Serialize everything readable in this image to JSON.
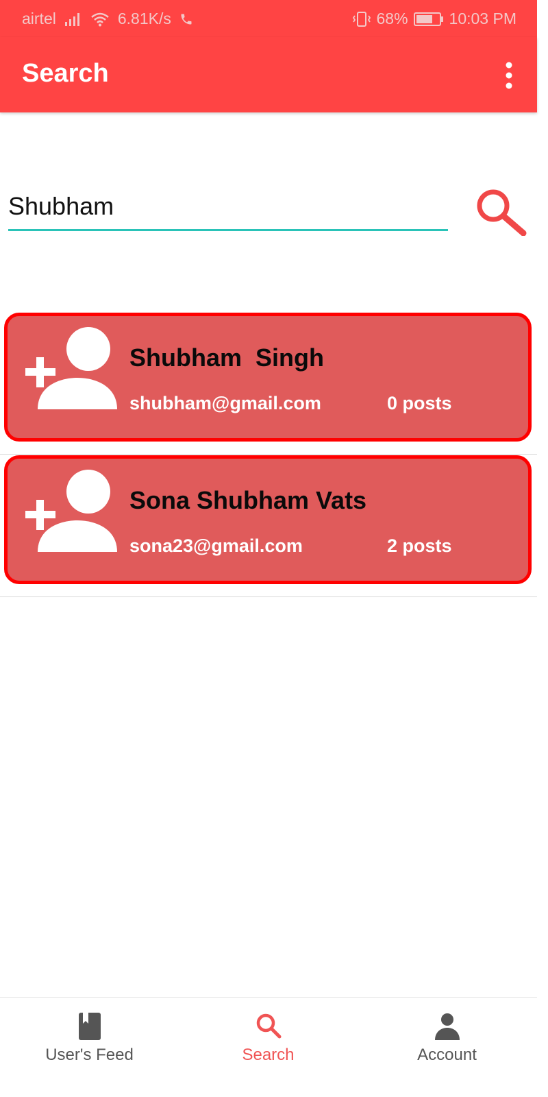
{
  "status_bar": {
    "carrier": "airtel",
    "speed": "6.81K/s",
    "battery": "68%",
    "time": "10:03 PM"
  },
  "app_bar": {
    "title": "Search",
    "menu_icon": "more-vert-icon"
  },
  "search": {
    "value": "Shubham",
    "button_icon": "search-icon"
  },
  "results": [
    {
      "name": "Shubham  Singh",
      "email": "shubham@gmail.com",
      "posts": "0 posts",
      "icon": "person-add-icon"
    },
    {
      "name": "Sona Shubham Vats",
      "email": "sona23@gmail.com",
      "posts": "2 posts",
      "icon": "person-add-icon"
    }
  ],
  "bottom_nav": {
    "items": [
      {
        "label": "User's Feed",
        "icon": "book-icon",
        "active": false
      },
      {
        "label": "Search",
        "icon": "search-icon",
        "active": true
      },
      {
        "label": "Account",
        "icon": "person-icon",
        "active": false
      }
    ]
  },
  "colors": {
    "primary": "#ff4444",
    "card_background": "#e05b5b",
    "card_border": "#ff0000",
    "input_underline": "#2ac3b8",
    "active_nav": "#f05454"
  }
}
